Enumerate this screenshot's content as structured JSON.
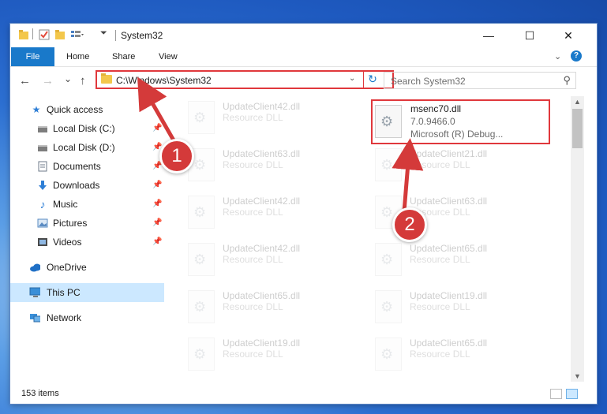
{
  "window": {
    "title": "System32",
    "controls": {
      "minimize": "—",
      "maximize": "☐",
      "close": "✕"
    }
  },
  "ribbon": {
    "tabs": [
      "File",
      "Home",
      "Share",
      "View"
    ],
    "collapse_icon": "chevron-down-icon",
    "help_label": "?"
  },
  "navigation": {
    "back": "←",
    "forward": "→",
    "recent": "⌄",
    "up": "↑",
    "address": "C:\\Windows\\System32",
    "search_placeholder": "Search System32"
  },
  "sidebar": {
    "items": [
      {
        "label": "Quick access",
        "icon": "star-icon",
        "color": "#2f7fd6",
        "pinned": false
      },
      {
        "label": "Local Disk (C:)",
        "icon": "drive-icon",
        "color": "#555555",
        "pinned": true
      },
      {
        "label": "Local Disk (D:)",
        "icon": "drive-icon",
        "color": "#555555",
        "pinned": true
      },
      {
        "label": "Documents",
        "icon": "document-icon",
        "color": "#6c7a89",
        "pinned": true
      },
      {
        "label": "Downloads",
        "icon": "download-icon",
        "color": "#2f7fd6",
        "pinned": true
      },
      {
        "label": "Music",
        "icon": "music-icon",
        "color": "#2f7fd6",
        "pinned": true
      },
      {
        "label": "Pictures",
        "icon": "pictures-icon",
        "color": "#5a8bc2",
        "pinned": true
      },
      {
        "label": "Videos",
        "icon": "video-icon",
        "color": "#4a4a4a",
        "pinned": true
      },
      {
        "label": "OneDrive",
        "icon": "cloud-icon",
        "color": "#1f6fc5",
        "pinned": false
      },
      {
        "label": "This PC",
        "icon": "computer-icon",
        "color": "#3a8fd8",
        "pinned": false,
        "selected": true
      },
      {
        "label": "Network",
        "icon": "network-icon",
        "color": "#3a8fd8",
        "pinned": false
      }
    ]
  },
  "files": {
    "left_column": [
      {
        "name": "UpdateClient42.dll",
        "type": "Resource DLL"
      },
      {
        "name": "UpdateClient63.dll",
        "type": "Resource DLL"
      },
      {
        "name": "UpdateClient42.dll",
        "type": "Resource DLL"
      },
      {
        "name": "UpdateClient42.dll",
        "type": "Resource DLL"
      },
      {
        "name": "UpdateClient65.dll",
        "type": "Resource DLL"
      },
      {
        "name": "UpdateClient19.dll",
        "type": "Resource DLL"
      }
    ],
    "right_column": [
      {
        "name": "msenc70.dll",
        "version": "7.0.9466.0",
        "description": "Microsoft (R) Debug...",
        "highlighted": true
      },
      {
        "name": "UpdateClient21.dll",
        "type": "Resource DLL"
      },
      {
        "name": "UpdateClient63.dll",
        "type": "Resource DLL"
      },
      {
        "name": "UpdateClient65.dll",
        "type": "Resource DLL"
      },
      {
        "name": "UpdateClient19.dll",
        "type": "Resource DLL"
      },
      {
        "name": "UpdateClient65.dll",
        "type": "Resource DLL"
      }
    ]
  },
  "status": {
    "item_count": "153 items"
  },
  "callouts": [
    {
      "number": "1"
    },
    {
      "number": "2"
    }
  ],
  "colors": {
    "accent": "#1979ca",
    "highlight_red": "#e0383c",
    "selected_bg": "#cce8ff"
  }
}
